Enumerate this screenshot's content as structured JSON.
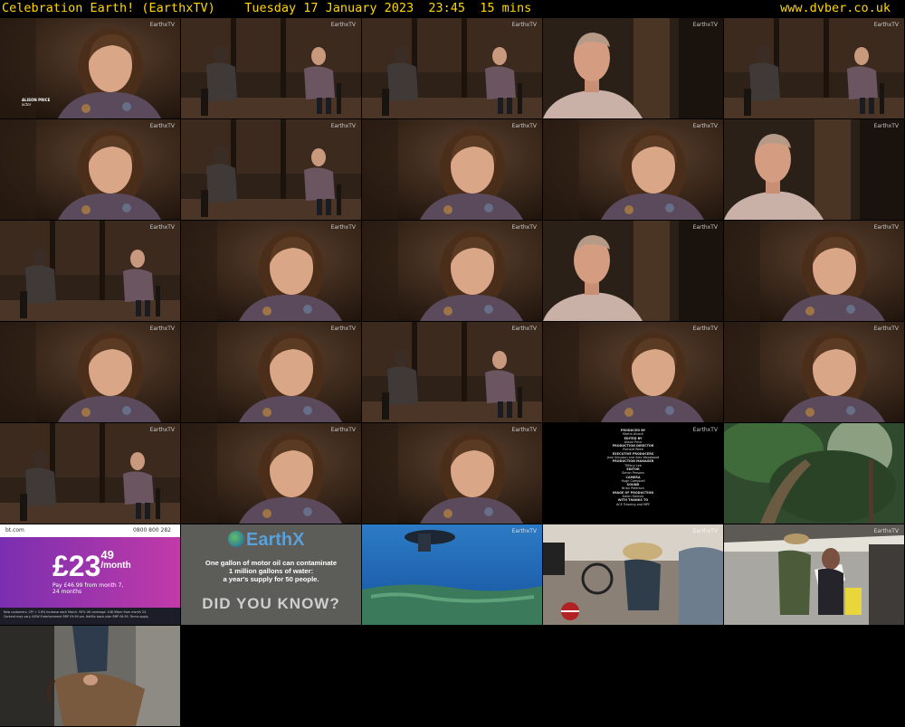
{
  "header": {
    "title": "Celebration Earth! (EarthxTV)    Tuesday 17 January 2023  23:45  15 mins",
    "site": "www.dvber.co.uk"
  },
  "watermark": "EarthxTV",
  "ads": {
    "bt": {
      "brand": "bt.com",
      "phone": "0800 800 282",
      "price_main": "£23",
      "price_pence": "49",
      "price_per": "/month",
      "sub1": "Pay £46.99 from month 7,",
      "sub2": "24 months",
      "fine1": "New customers. CPI + 3.9% increase each March. 95% UK coverage. £46.99pm from month 25.",
      "fine2": "Content may vary. NOW Entertainment RRP £9.99 pm. Netflix basic plan RRP £6.99. Terms apply."
    },
    "earthx": {
      "logo": "EarthX",
      "line1": "One gallon of motor oil can contaminate",
      "line2": "1 million gallons of water:",
      "line3": "a year's supply for 50 people.",
      "tagline": "DID YOU KNOW?"
    }
  },
  "credits_lines": [
    "PRODUCED BY",
    "Martin Alcock",
    "EDITED BY",
    "Alison Price",
    "PRODUCTION DIRECTOR",
    "Richard Reed",
    "EXECUTIVE PRODUCERS",
    "Jane Simpson and Alex Woodward",
    "PRODUCTION MANAGER",
    "Tiffany Lee",
    "EDITOR",
    "Simon Parsons",
    "CAMERA",
    "Hugh Campbell",
    "SOUND",
    "Brian Peterson",
    "IMAGE OF PRODUCTION",
    "Karen Holmes",
    "WITH THANKS TO",
    "ACE Tutoring and MPF"
  ],
  "lower_third": {
    "line1": "ALISON PRICE",
    "line2": "actor"
  },
  "colors": {
    "header_text": "#ffd700",
    "background": "#000000",
    "bt_purple": "#7a2fb0"
  },
  "thumbnails": [
    {
      "scene": "woman-closeup"
    },
    {
      "scene": "wide-two-chairs"
    },
    {
      "scene": "wide-two-chairs"
    },
    {
      "scene": "man-interview"
    },
    {
      "scene": "wide-two-chairs"
    },
    {
      "scene": "woman-closeup"
    },
    {
      "scene": "wide-two-chairs"
    },
    {
      "scene": "woman-closeup"
    },
    {
      "scene": "woman-closeup"
    },
    {
      "scene": "man-interview"
    },
    {
      "scene": "wide-two-chairs"
    },
    {
      "scene": "woman-closeup"
    },
    {
      "scene": "woman-closeup"
    },
    {
      "scene": "man-interview"
    },
    {
      "scene": "woman-closeup"
    },
    {
      "scene": "woman-closeup"
    },
    {
      "scene": "woman-closeup"
    },
    {
      "scene": "wide-two-chairs"
    },
    {
      "scene": "woman-closeup"
    },
    {
      "scene": "woman-closeup"
    },
    {
      "scene": "wide-two-chairs"
    },
    {
      "scene": "woman-closeup"
    },
    {
      "scene": "woman-closeup"
    },
    {
      "scene": "credits"
    },
    {
      "scene": "forest"
    },
    {
      "scene": "ad-bt"
    },
    {
      "scene": "ad-earthx"
    },
    {
      "scene": "underwater"
    },
    {
      "scene": "group-bikes"
    },
    {
      "scene": "group-papers"
    },
    {
      "scene": "horse"
    }
  ]
}
